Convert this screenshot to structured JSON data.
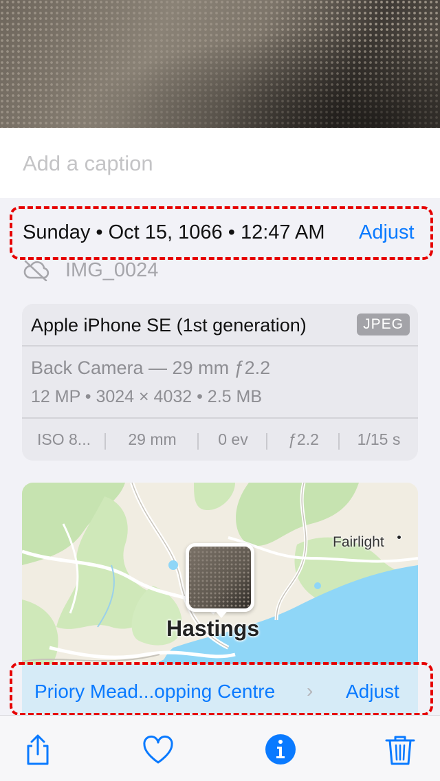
{
  "caption": {
    "placeholder": "Add a caption"
  },
  "datetime": {
    "text": "Sunday • Oct 15, 1066 • 12:47 AM",
    "adjust_label": "Adjust"
  },
  "file": {
    "name": "IMG_0024",
    "icon": "cloud-off-icon"
  },
  "camera": {
    "model": "Apple iPhone SE (1st generation)",
    "format": "JPEG",
    "lens": "Back Camera — 29 mm ƒ2.2",
    "specs": "12 MP  •  3024 × 4032  •  2.5 MB",
    "exif": [
      "ISO 8...",
      "29 mm",
      "0 ev",
      "ƒ2.2",
      "1/15 s"
    ]
  },
  "map": {
    "city": "Hastings",
    "town": "Fairlight"
  },
  "location": {
    "name": "Priory Mead...opping Centre",
    "chevron": "›",
    "adjust_label": "Adjust"
  },
  "toolbar": {
    "items": [
      "share-icon",
      "heart-icon",
      "info-icon",
      "trash-icon"
    ],
    "accent": "#0a7aff"
  },
  "colors": {
    "accent": "#0a7aff",
    "highlight": "#e60000"
  }
}
